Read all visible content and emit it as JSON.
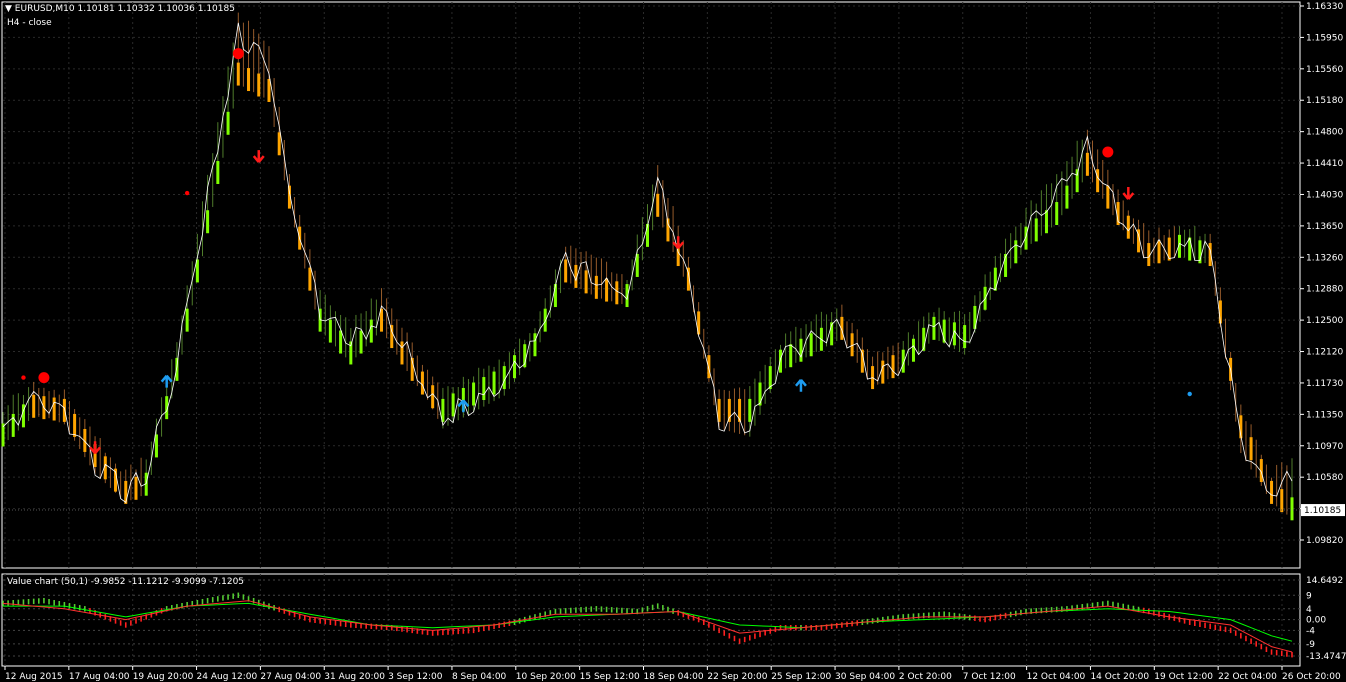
{
  "header": {
    "symbol_line": "EURUSD,M10  1.10181 1.10332 1.10036 1.10185",
    "indicator_line": "H4 - close"
  },
  "sub_window": {
    "title": "Value chart (50,1) -9.9852 -11.1212 -9.9099 -7.1205"
  },
  "colors": {
    "bg": "#000000",
    "up_bar": "#7fff00",
    "down_bar": "#ffa500",
    "line": "#ffffff",
    "up_arrow": "#1e9cf0",
    "down_arrow": "#ff1a1a",
    "dot": "#ff0000",
    "vc_up": "#55cc33",
    "vc_down": "#ff2020",
    "vc_line_green": "#00ff00",
    "vc_line_red": "#ff3030"
  },
  "price_axis": {
    "labels": [
      "1.16330",
      "1.15950",
      "1.15560",
      "1.15180",
      "1.14800",
      "1.14410",
      "1.14030",
      "1.13650",
      "1.13260",
      "1.12880",
      "1.12500",
      "1.12120",
      "1.11730",
      "1.11350",
      "1.10970",
      "1.10580",
      "1.10185",
      "1.09820"
    ],
    "current": "1.10185"
  },
  "sub_axis": {
    "labels": [
      "14.6492",
      "9",
      "4",
      "0.00",
      "-4",
      "-9",
      "-13.4747"
    ]
  },
  "time_axis": {
    "labels": [
      "12 Aug 2015",
      "17 Aug 04:00",
      "19 Aug 20:00",
      "24 Aug 12:00",
      "27 Aug 04:00",
      "31 Aug 20:00",
      "3 Sep 12:00",
      "8 Sep 04:00",
      "10 Sep 20:00",
      "15 Sep 12:00",
      "18 Sep 04:00",
      "22 Sep 20:00",
      "25 Sep 12:00",
      "30 Sep 04:00",
      "2 Oct 20:00",
      "7 Oct 12:00",
      "12 Oct 04:00",
      "14 Oct 20:00",
      "19 Oct 12:00",
      "22 Oct 04:00",
      "26 Oct 20:00"
    ]
  },
  "chart_data": {
    "type": "line",
    "symbol": "EURUSD",
    "timeframe": "M10",
    "ylim": [
      1.0982,
      1.1633
    ],
    "close_path": [
      [
        0,
        1.112
      ],
      [
        3,
        1.115
      ],
      [
        6,
        1.1135
      ],
      [
        9,
        1.1075
      ],
      [
        12,
        1.104
      ],
      [
        14,
        1.106
      ],
      [
        17,
        1.12
      ],
      [
        20,
        1.14
      ],
      [
        23,
        1.16
      ],
      [
        26,
        1.156
      ],
      [
        28,
        1.14
      ],
      [
        31,
        1.126
      ],
      [
        34,
        1.122
      ],
      [
        37,
        1.126
      ],
      [
        40,
        1.12
      ],
      [
        43,
        1.113
      ],
      [
        46,
        1.115
      ],
      [
        49,
        1.117
      ],
      [
        52,
        1.122
      ],
      [
        55,
        1.132
      ],
      [
        58,
        1.13
      ],
      [
        61,
        1.128
      ],
      [
        64,
        1.142
      ],
      [
        67,
        1.13
      ],
      [
        70,
        1.113
      ],
      [
        73,
        1.112
      ],
      [
        76,
        1.12
      ],
      [
        79,
        1.123
      ],
      [
        82,
        1.124
      ],
      [
        85,
        1.118
      ],
      [
        88,
        1.12
      ],
      [
        91,
        1.124
      ],
      [
        94,
        1.122
      ],
      [
        97,
        1.13
      ],
      [
        100,
        1.136
      ],
      [
        103,
        1.14
      ],
      [
        106,
        1.146
      ],
      [
        109,
        1.138
      ],
      [
        112,
        1.133
      ],
      [
        115,
        1.134
      ],
      [
        118,
        1.133
      ],
      [
        121,
        1.11
      ],
      [
        124,
        1.104
      ],
      [
        126,
        1.106
      ]
    ],
    "trend_path": [
      [
        0,
        1.111
      ],
      [
        3,
        1.1145
      ],
      [
        6,
        1.114
      ],
      [
        9,
        1.1085
      ],
      [
        12,
        1.104
      ],
      [
        14,
        1.105
      ],
      [
        17,
        1.119
      ],
      [
        20,
        1.137
      ],
      [
        23,
        1.155
      ],
      [
        26,
        1.153
      ],
      [
        28,
        1.14
      ],
      [
        31,
        1.125
      ],
      [
        34,
        1.121
      ],
      [
        37,
        1.125
      ],
      [
        40,
        1.119
      ],
      [
        43,
        1.114
      ],
      [
        46,
        1.116
      ],
      [
        49,
        1.118
      ],
      [
        52,
        1.122
      ],
      [
        55,
        1.131
      ],
      [
        58,
        1.129
      ],
      [
        61,
        1.128
      ],
      [
        64,
        1.139
      ],
      [
        67,
        1.13
      ],
      [
        70,
        1.114
      ],
      [
        73,
        1.114
      ],
      [
        76,
        1.12
      ],
      [
        79,
        1.122
      ],
      [
        82,
        1.124
      ],
      [
        85,
        1.118
      ],
      [
        88,
        1.12
      ],
      [
        91,
        1.124
      ],
      [
        94,
        1.123
      ],
      [
        97,
        1.13
      ],
      [
        100,
        1.135
      ],
      [
        103,
        1.138
      ],
      [
        106,
        1.144
      ],
      [
        109,
        1.138
      ],
      [
        112,
        1.133
      ],
      [
        115,
        1.134
      ],
      [
        118,
        1.133
      ],
      [
        121,
        1.112
      ],
      [
        124,
        1.104
      ],
      [
        126,
        1.102
      ]
    ],
    "down_segments": [
      [
        3,
        14
      ],
      [
        23,
        31
      ],
      [
        37,
        43
      ],
      [
        55,
        61
      ],
      [
        64,
        73
      ],
      [
        82,
        88
      ],
      [
        106,
        115
      ],
      [
        118,
        126
      ]
    ],
    "up_arrows": [
      [
        16,
        1.1175
      ],
      [
        45,
        1.1145
      ],
      [
        78,
        1.117
      ]
    ],
    "down_arrows": [
      [
        9,
        1.1095
      ],
      [
        25,
        1.145
      ],
      [
        66,
        1.1345
      ],
      [
        110,
        1.1405
      ]
    ],
    "big_dots": [
      [
        4,
        1.118
      ],
      [
        23,
        1.1575
      ],
      [
        108,
        1.1455
      ]
    ],
    "small_dots": [
      [
        2,
        1.118
      ],
      [
        18,
        1.1405
      ],
      [
        116,
        1.116
      ]
    ],
    "sub_ylim": [
      -13.4747,
      14.6492
    ],
    "value_chart": [
      [
        0,
        6
      ],
      [
        4,
        7
      ],
      [
        8,
        4
      ],
      [
        12,
        -2
      ],
      [
        16,
        4
      ],
      [
        20,
        7
      ],
      [
        23,
        9
      ],
      [
        26,
        5
      ],
      [
        30,
        0
      ],
      [
        34,
        -2
      ],
      [
        38,
        -3
      ],
      [
        42,
        -5
      ],
      [
        46,
        -4
      ],
      [
        50,
        -1
      ],
      [
        54,
        3
      ],
      [
        58,
        4
      ],
      [
        62,
        3
      ],
      [
        64,
        5
      ],
      [
        68,
        0
      ],
      [
        72,
        -8
      ],
      [
        76,
        -3
      ],
      [
        80,
        -3
      ],
      [
        84,
        -1
      ],
      [
        88,
        1
      ],
      [
        92,
        2
      ],
      [
        96,
        0
      ],
      [
        100,
        3
      ],
      [
        104,
        4
      ],
      [
        108,
        6
      ],
      [
        112,
        3
      ],
      [
        116,
        -1
      ],
      [
        120,
        -4
      ],
      [
        124,
        -12
      ],
      [
        126,
        -13
      ]
    ],
    "vc_green_line": [
      [
        0,
        5
      ],
      [
        6,
        5
      ],
      [
        12,
        1
      ],
      [
        18,
        5
      ],
      [
        24,
        6
      ],
      [
        30,
        2
      ],
      [
        36,
        -2
      ],
      [
        42,
        -3
      ],
      [
        48,
        -2
      ],
      [
        54,
        1
      ],
      [
        60,
        2
      ],
      [
        66,
        3
      ],
      [
        72,
        -2
      ],
      [
        78,
        -3
      ],
      [
        84,
        -1
      ],
      [
        90,
        0
      ],
      [
        96,
        1
      ],
      [
        102,
        3
      ],
      [
        108,
        4
      ],
      [
        114,
        3
      ],
      [
        120,
        0
      ],
      [
        124,
        -6
      ],
      [
        126,
        -8
      ]
    ],
    "vc_red_line": [
      [
        0,
        6
      ],
      [
        6,
        4
      ],
      [
        12,
        0
      ],
      [
        18,
        5
      ],
      [
        24,
        7
      ],
      [
        30,
        1
      ],
      [
        36,
        -2
      ],
      [
        42,
        -4
      ],
      [
        48,
        -2
      ],
      [
        54,
        2
      ],
      [
        60,
        2
      ],
      [
        66,
        3
      ],
      [
        72,
        -5
      ],
      [
        78,
        -3
      ],
      [
        84,
        -1
      ],
      [
        90,
        1
      ],
      [
        96,
        1
      ],
      [
        102,
        3
      ],
      [
        108,
        5
      ],
      [
        114,
        1
      ],
      [
        120,
        -2
      ],
      [
        124,
        -10
      ],
      [
        126,
        -12
      ]
    ]
  }
}
